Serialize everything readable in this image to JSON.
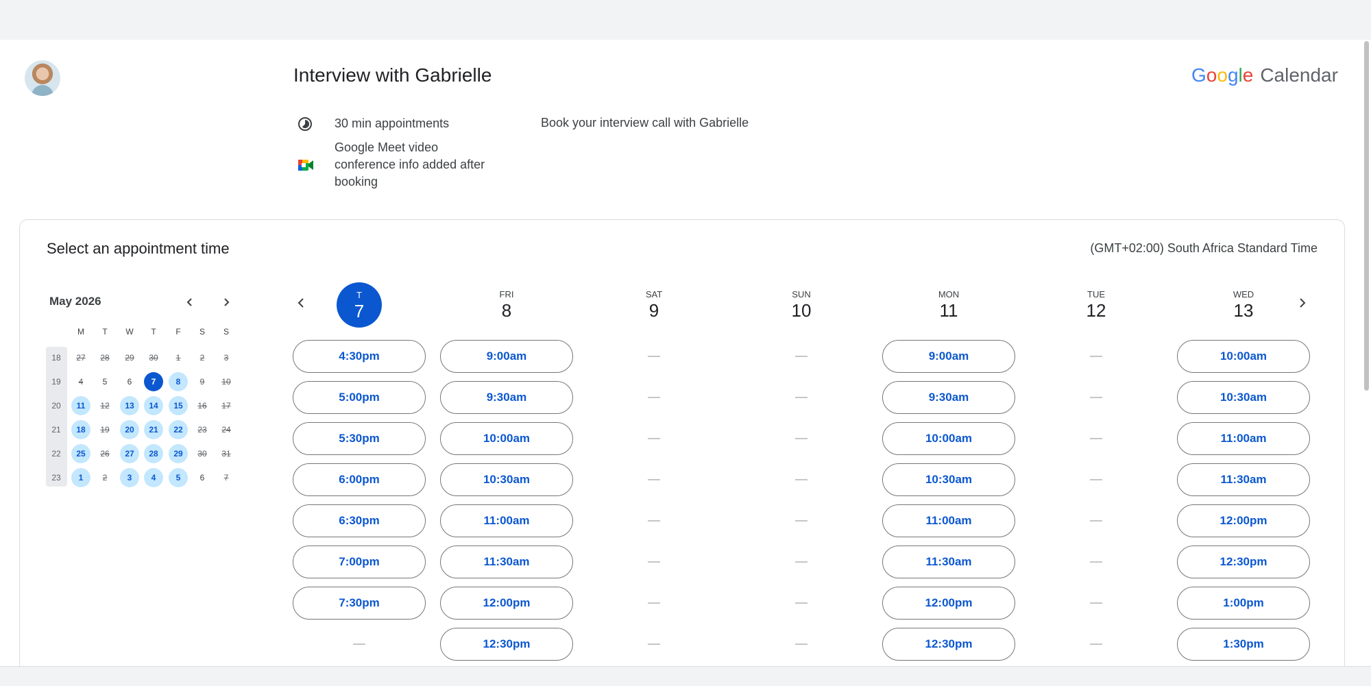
{
  "header": {
    "title": "Interview with Gabrielle",
    "brand_letters": [
      "G",
      "o",
      "o",
      "g",
      "l",
      "e"
    ],
    "brand_product": "Calendar"
  },
  "info": {
    "duration": "30 min appointments",
    "meet": "Google Meet video conference info added after booking",
    "description": "Book your interview call with Gabrielle"
  },
  "booking": {
    "title": "Select an appointment time",
    "timezone": "(GMT+02:00) South Africa Standard Time"
  },
  "mini_calendar": {
    "month": "May 2026",
    "weekday_headers": [
      "M",
      "T",
      "W",
      "T",
      "F",
      "S",
      "S"
    ],
    "weeks": [
      {
        "week": "18",
        "days": [
          {
            "d": "27",
            "s": "disabled"
          },
          {
            "d": "28",
            "s": "disabled"
          },
          {
            "d": "29",
            "s": "disabled"
          },
          {
            "d": "30",
            "s": "disabled"
          },
          {
            "d": "1",
            "s": "disabled"
          },
          {
            "d": "2",
            "s": "disabled"
          },
          {
            "d": "3",
            "s": "disabled"
          }
        ]
      },
      {
        "week": "19",
        "days": [
          {
            "d": "4",
            "s": "disabled"
          },
          {
            "d": "5",
            "s": "normal"
          },
          {
            "d": "6",
            "s": "normal"
          },
          {
            "d": "7",
            "s": "selected"
          },
          {
            "d": "8",
            "s": "available"
          },
          {
            "d": "9",
            "s": "disabled"
          },
          {
            "d": "10",
            "s": "disabled"
          }
        ]
      },
      {
        "week": "20",
        "days": [
          {
            "d": "11",
            "s": "available"
          },
          {
            "d": "12",
            "s": "disabled"
          },
          {
            "d": "13",
            "s": "available"
          },
          {
            "d": "14",
            "s": "available"
          },
          {
            "d": "15",
            "s": "available"
          },
          {
            "d": "16",
            "s": "disabled"
          },
          {
            "d": "17",
            "s": "disabled"
          }
        ]
      },
      {
        "week": "21",
        "days": [
          {
            "d": "18",
            "s": "available"
          },
          {
            "d": "19",
            "s": "disabled"
          },
          {
            "d": "20",
            "s": "available"
          },
          {
            "d": "21",
            "s": "available"
          },
          {
            "d": "22",
            "s": "available"
          },
          {
            "d": "23",
            "s": "disabled"
          },
          {
            "d": "24",
            "s": "disabled"
          }
        ]
      },
      {
        "week": "22",
        "days": [
          {
            "d": "25",
            "s": "available"
          },
          {
            "d": "26",
            "s": "disabled"
          },
          {
            "d": "27",
            "s": "available"
          },
          {
            "d": "28",
            "s": "available"
          },
          {
            "d": "29",
            "s": "available"
          },
          {
            "d": "30",
            "s": "disabled"
          },
          {
            "d": "31",
            "s": "disabled"
          }
        ]
      },
      {
        "week": "23",
        "days": [
          {
            "d": "1",
            "s": "available"
          },
          {
            "d": "2",
            "s": "disabled"
          },
          {
            "d": "3",
            "s": "available"
          },
          {
            "d": "4",
            "s": "available"
          },
          {
            "d": "5",
            "s": "available"
          },
          {
            "d": "6",
            "s": "normal"
          },
          {
            "d": "7",
            "s": "disabled"
          }
        ]
      }
    ]
  },
  "days": [
    {
      "abbr": "T",
      "num": "7",
      "today": true,
      "slots": [
        "4:30pm",
        "5:00pm",
        "5:30pm",
        "6:00pm",
        "6:30pm",
        "7:00pm",
        "7:30pm",
        null
      ]
    },
    {
      "abbr": "FRI",
      "num": "8",
      "today": false,
      "slots": [
        "9:00am",
        "9:30am",
        "10:00am",
        "10:30am",
        "11:00am",
        "11:30am",
        "12:00pm",
        "12:30pm"
      ]
    },
    {
      "abbr": "SAT",
      "num": "9",
      "today": false,
      "slots": [
        null,
        null,
        null,
        null,
        null,
        null,
        null,
        null
      ]
    },
    {
      "abbr": "SUN",
      "num": "10",
      "today": false,
      "slots": [
        null,
        null,
        null,
        null,
        null,
        null,
        null,
        null
      ]
    },
    {
      "abbr": "MON",
      "num": "11",
      "today": false,
      "slots": [
        "9:00am",
        "9:30am",
        "10:00am",
        "10:30am",
        "11:00am",
        "11:30am",
        "12:00pm",
        "12:30pm"
      ]
    },
    {
      "abbr": "TUE",
      "num": "12",
      "today": false,
      "slots": [
        null,
        null,
        null,
        null,
        null,
        null,
        null,
        null
      ]
    },
    {
      "abbr": "WED",
      "num": "13",
      "today": false,
      "slots": [
        "10:00am",
        "10:30am",
        "11:00am",
        "11:30am",
        "12:00pm",
        "12:30pm",
        "1:00pm",
        "1:30pm"
      ]
    }
  ],
  "icons": {
    "duration": "timelapse-icon",
    "meet": "google-meet-icon",
    "prev": "chevron-left-icon",
    "next": "chevron-right-icon"
  },
  "colors": {
    "accent": "#0b57d0",
    "available_day": "#c2e7ff"
  }
}
